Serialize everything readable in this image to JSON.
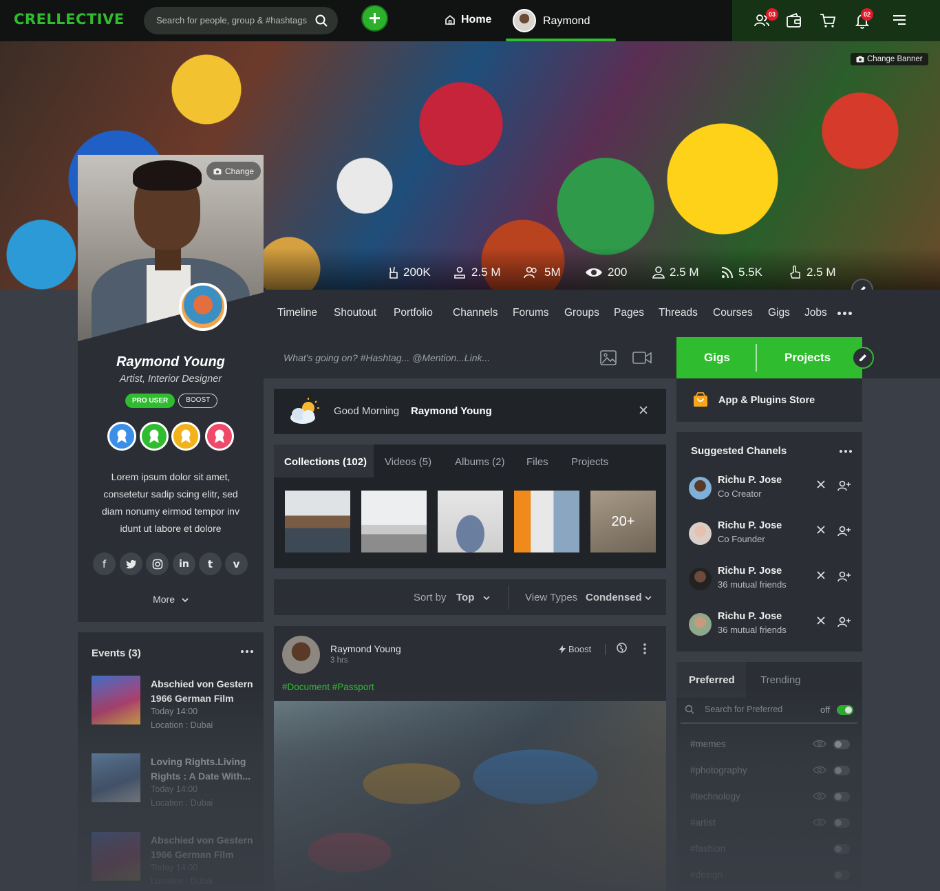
{
  "app": {
    "logo": "CRELLECTIVE"
  },
  "topbar": {
    "search_placeholder": "Search for people, group & #hashtags",
    "home_label": "Home",
    "user_name": "Raymond",
    "friends_badge": "03",
    "notifications_badge": "02"
  },
  "banner": {
    "change_banner_label": "Change Banner",
    "stats": [
      "200K",
      "2.5 M",
      "5M",
      "200",
      "2.5 M",
      "5.5K",
      "2.5 M"
    ]
  },
  "profile": {
    "change_label": "Change",
    "name": "Raymond Young",
    "role": "Artist, Interior Designer",
    "pro_label": "PRO USER",
    "boost_label": "BOOST",
    "bio": "Lorem ipsum dolor sit amet, consetetur sadip scing elitr, sed diam nonumy eirmod tempor inv idunt ut labore et dolore",
    "social": [
      "f",
      "t",
      "ig",
      "in",
      "t",
      "v"
    ],
    "more_label": "More",
    "award_colors": [
      "#3b8fe6",
      "#2fbd2f",
      "#f2b21a",
      "#f04a6a"
    ]
  },
  "tabs": [
    "Timeline",
    "Shoutout",
    "Portfolio",
    "Channels",
    "Forums",
    "Groups",
    "Pages",
    "Threads",
    "Courses",
    "Gigs",
    "Jobs"
  ],
  "composer": {
    "placeholder": "What's going on? #Hashtag... @Mention...Link..."
  },
  "greeting": {
    "prefix": "Good Morning",
    "name": "Raymond Young"
  },
  "collections": {
    "tabs": [
      "Collections (102)",
      "Videos (5)",
      "Albums (2)",
      "Files",
      "Projects"
    ],
    "more_count": "20+"
  },
  "sort": {
    "sort_label": "Sort by",
    "sort_value": "Top",
    "view_label": "View Types",
    "view_value": "Condensed"
  },
  "post": {
    "author": "Raymond Young",
    "time": "3 hrs",
    "boost_label": "Boost",
    "tags": "#Document   #Passport"
  },
  "right": {
    "gigs_label": "Gigs",
    "projects_label": "Projects",
    "store_label": "App & Plugins Store",
    "suggested_title": "Suggested Chanels",
    "suggested": [
      {
        "name": "Richu P. Jose",
        "role": "Co Creator"
      },
      {
        "name": "Richu P. Jose",
        "role": "Co Founder"
      },
      {
        "name": "Richu P. Jose",
        "role": "36 mutual friends"
      },
      {
        "name": "Richu P. Jose",
        "role": "36 mutual friends"
      }
    ],
    "pref_tab": "Preferred",
    "trend_tab": "Trending",
    "pref_search": "Search for Preferred",
    "pref_toggle": "off",
    "hashtags": [
      "#memes",
      "#photography",
      "#technology",
      "#artist",
      "#fashion",
      "#design"
    ]
  },
  "events": {
    "title": "Events (3)",
    "items": [
      {
        "title": "Abschied von Gestern 1966 German Film",
        "time": "Today 14:00",
        "location": "Location : Dubai"
      },
      {
        "title": "Loving Rights.Living Rights : A Date With...",
        "time": "Today 14:00",
        "location": "Location : Dubai"
      },
      {
        "title": "Abschied von Gestern 1966 German Film",
        "time": "Today 14:00",
        "location": "Location : Dubai"
      }
    ]
  },
  "colors": {
    "accent": "#2fbd2f",
    "panel": "#2b2f35",
    "page": "#3a3f47"
  }
}
